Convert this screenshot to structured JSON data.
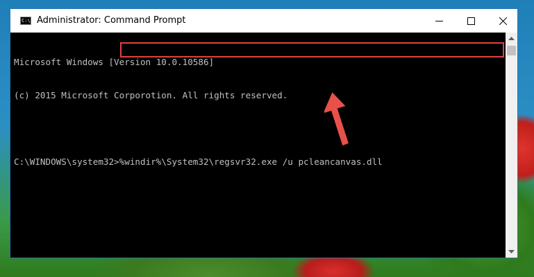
{
  "window": {
    "title": "Administrator: Command Prompt",
    "icon": "C:\\"
  },
  "console": {
    "lines": [
      "Microsoft Windows [Version 10.0.10586]",
      "(c) 2015 Microsoft Corporotion. All rights reserved."
    ],
    "prompt": "C:\\WINDOWS\\system32>",
    "command": "%windir%\\System32\\regsvr32.exe /u pcleancanvas.dll"
  },
  "colors": {
    "highlight": "#e0443c",
    "arrow": "#e8504a",
    "titlebar": "#ffffff",
    "console_text": "#c0c0c0"
  },
  "icons": [
    "cmd-app-icon",
    "minimize-icon",
    "maximize-icon",
    "close-icon",
    "scroll-up-icon",
    "scroll-down-icon",
    "red-arrow-icon"
  ]
}
